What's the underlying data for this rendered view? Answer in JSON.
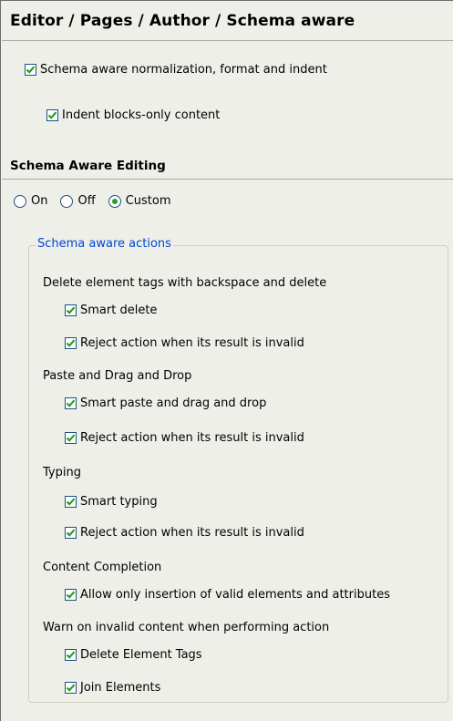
{
  "page": {
    "title": "Editor / Pages / Author / Schema aware"
  },
  "options": {
    "normalization": {
      "label": "Schema aware normalization, format and indent",
      "checked": true
    },
    "indent_blocks": {
      "label": "Indent blocks-only content",
      "checked": true
    }
  },
  "schema_editing": {
    "heading": "Schema Aware Editing",
    "radios": [
      {
        "label": "On",
        "selected": false
      },
      {
        "label": "Off",
        "selected": false
      },
      {
        "label": "Custom",
        "selected": true
      }
    ]
  },
  "actions": {
    "legend": "Schema aware actions",
    "groups": [
      {
        "label": "Delete element tags with backspace and delete",
        "items": [
          {
            "label": "Smart delete",
            "checked": true
          },
          {
            "label": "Reject action when its result is invalid",
            "checked": true
          }
        ]
      },
      {
        "label": "Paste and Drag and Drop",
        "items": [
          {
            "label": "Smart paste and drag and drop",
            "checked": true
          },
          {
            "label": "Reject action when its result is invalid",
            "checked": true
          }
        ]
      },
      {
        "label": "Typing",
        "items": [
          {
            "label": "Smart typing",
            "checked": true
          },
          {
            "label": "Reject action when its result is invalid",
            "checked": true
          }
        ]
      },
      {
        "label": "Content Completion",
        "items": [
          {
            "label": "Allow only insertion of valid elements and attributes",
            "checked": true
          }
        ]
      },
      {
        "label": "Warn on invalid content when performing action",
        "items": [
          {
            "label": "Delete Element Tags",
            "checked": true
          },
          {
            "label": "Join Elements",
            "checked": true
          }
        ]
      }
    ]
  },
  "colors": {
    "background": "#efefe9",
    "checkmark": "#21a121",
    "control_border": "#1c5180",
    "legend_text": "#0046d5"
  },
  "icons": {
    "checkbox_checked": "checkmark-icon",
    "radio_selected": "radio-dot-icon"
  }
}
